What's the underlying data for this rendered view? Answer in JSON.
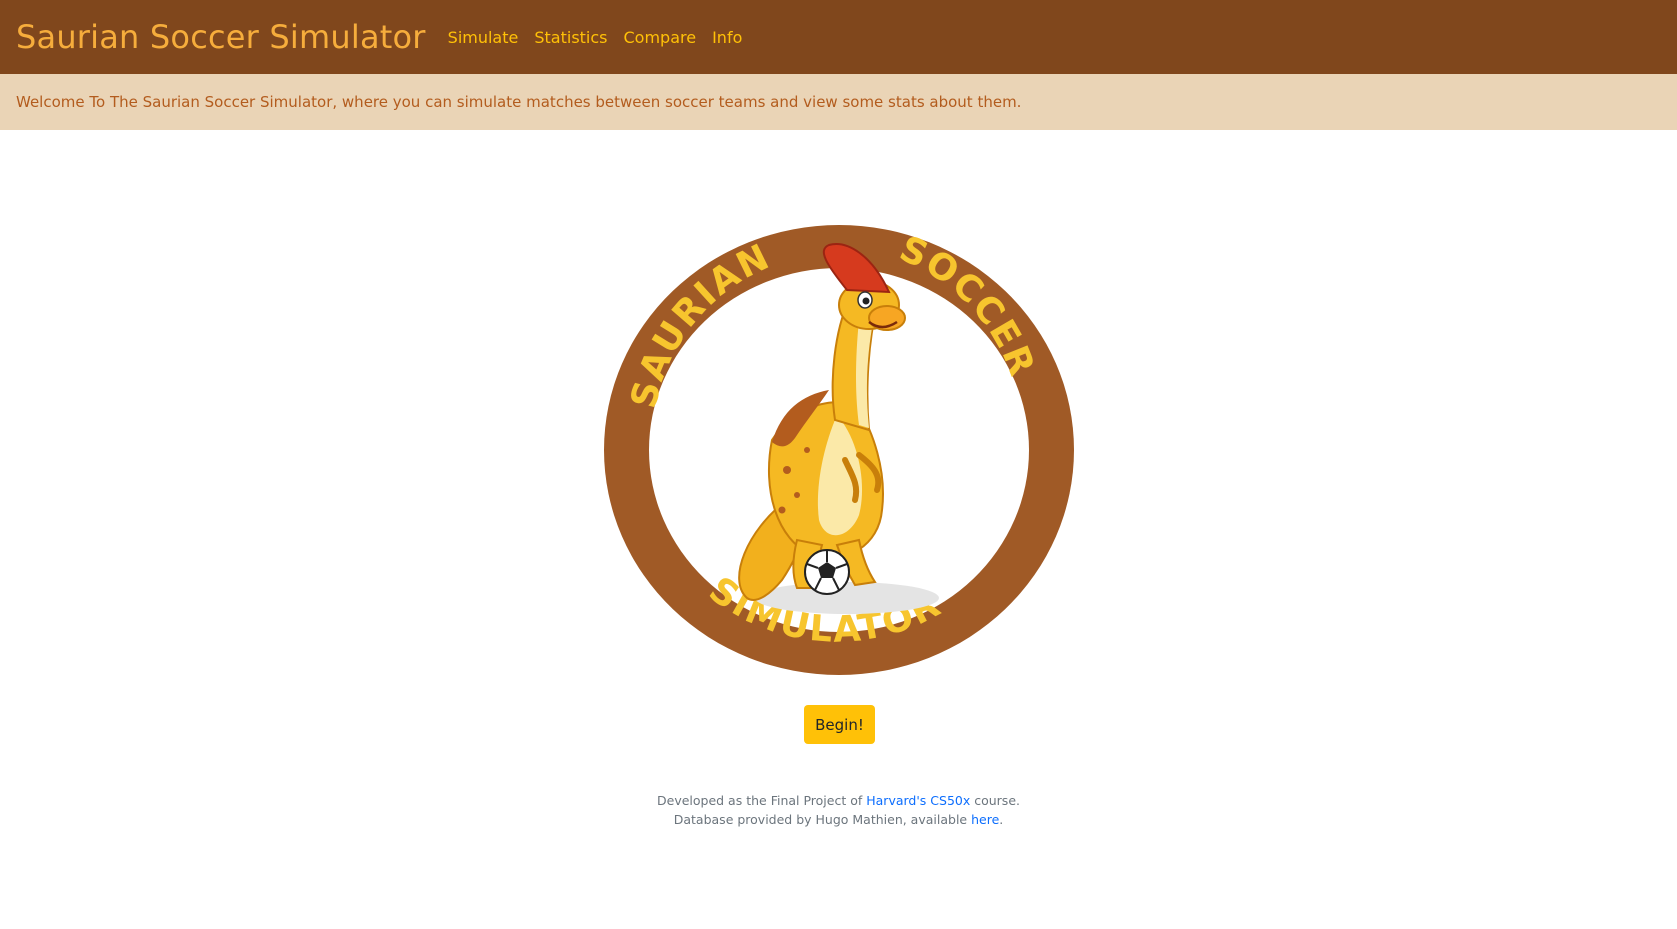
{
  "navbar": {
    "brand": "Saurian Soccer Simulator",
    "links": [
      "Simulate",
      "Statistics",
      "Compare",
      "Info"
    ],
    "background_color": "#80471c",
    "brand_color": "#f6ad3c",
    "link_color": "#ffc107"
  },
  "alert": {
    "text": "Welcome To The Saurian Soccer Simulator, where you can simulate matches between soccer teams and view some stats about them.",
    "background_color": "#ead4b6",
    "text_color": "#b35c1e"
  },
  "logo": {
    "top_text_left": "SAURIAN",
    "top_text_right": "SOCCER",
    "bottom_text": "SIMULATOR",
    "ring_color": "#a05a26",
    "lettering_color": "#f7c52e"
  },
  "begin_button": {
    "label": "Begin!",
    "color": "#ffc107"
  },
  "footer": {
    "line1_prefix": "Developed as the Final Project of ",
    "line1_link": "Harvard's CS50x",
    "line1_suffix": " course.",
    "line2_prefix": "Database provided by Hugo Mathien, available ",
    "line2_link": "here",
    "line2_suffix": "."
  }
}
